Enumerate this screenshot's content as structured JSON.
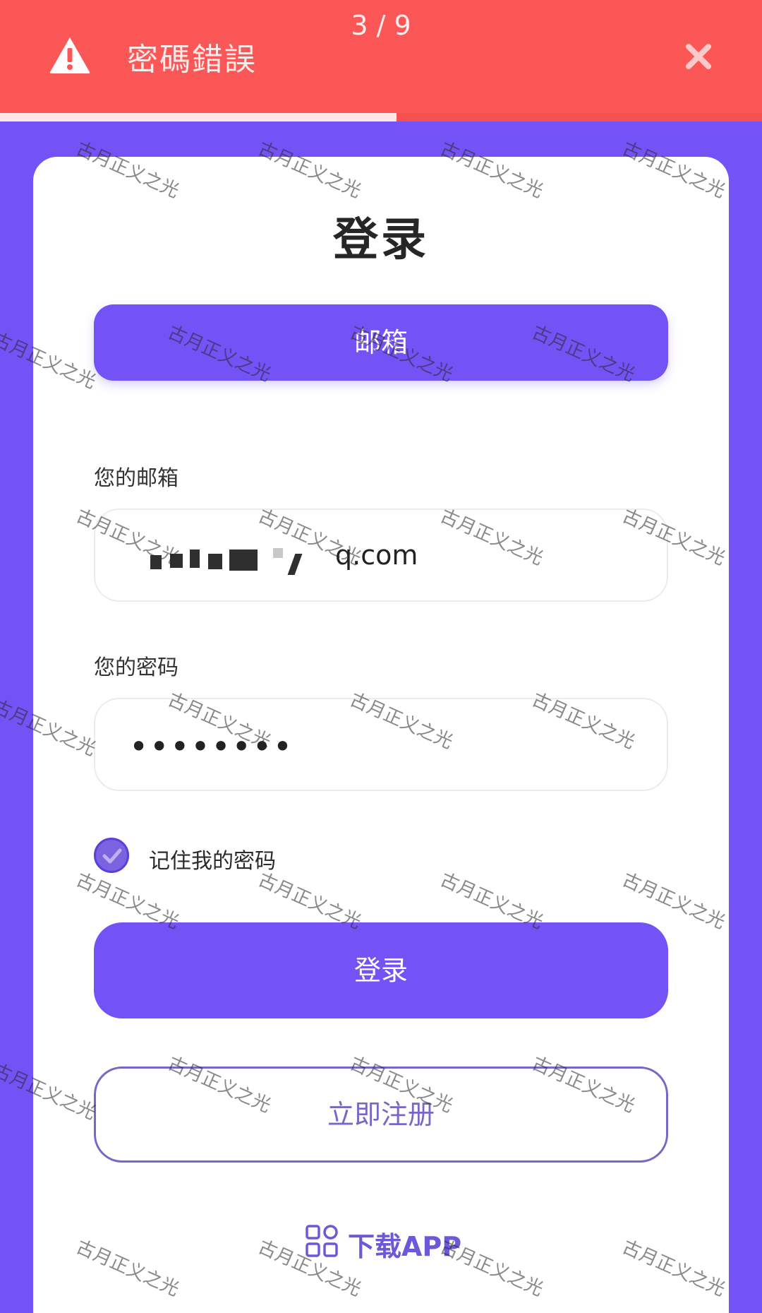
{
  "toast": {
    "message": "密碼錯誤",
    "counter": "3 / 9",
    "icon": "warning-triangle-icon",
    "close_icon": "close-icon",
    "progress": 0.52
  },
  "login": {
    "title": "登录",
    "tab_email": "邮箱",
    "email_label": "您的邮箱",
    "email_value_visible_suffix": "q.com",
    "password_label": "您的密码",
    "password_value_masked": "••••••••",
    "remember_label": "记住我的密码",
    "remember_checked": true,
    "login_button": "登录",
    "register_button": "立即注册",
    "download_label": "下载APP",
    "download_icon": "grid-apps-icon"
  },
  "watermark": "古月正义之光",
  "colors": {
    "brand": "#7453f6",
    "toast_bg": "#fb5757",
    "card_bg": "#ffffff",
    "register_border": "#7a66c6"
  }
}
